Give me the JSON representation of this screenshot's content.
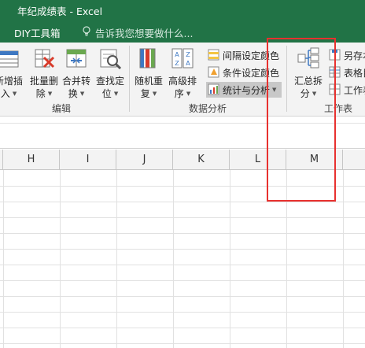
{
  "window": {
    "title": "年纪成绩表 - Excel"
  },
  "tabs": {
    "active": "DIY工具箱",
    "tell_me_placeholder": "告诉我您想要做什么..."
  },
  "ribbon": {
    "edit_group": {
      "label": "编辑",
      "buttons": [
        {
          "l1": "新增插",
          "l2": "入",
          "icon": "insert-rows-icon"
        },
        {
          "l1": "批量删",
          "l2": "除",
          "icon": "batch-delete-icon"
        },
        {
          "l1": "合并转",
          "l2": "换",
          "icon": "merge-convert-icon"
        },
        {
          "l1": "查找定",
          "l2": "位",
          "icon": "find-locate-icon"
        }
      ]
    },
    "analysis_group": {
      "label": "数据分析",
      "buttons": [
        {
          "l1": "随机重",
          "l2": "复",
          "icon": "random-repeat-icon"
        },
        {
          "l1": "高级排",
          "l2": "序",
          "icon": "advanced-sort-icon"
        }
      ],
      "small_buttons": [
        {
          "label": "间隔设定颜色",
          "icon": "interval-color-icon"
        },
        {
          "label": "条件设定颜色",
          "icon": "condition-color-icon"
        },
        {
          "label": "统计与分析",
          "icon": "statistics-analysis-icon"
        }
      ]
    },
    "sheet_group": {
      "label": "工作表",
      "summary_button": {
        "l1": "汇总拆",
        "l2": "分",
        "icon": "summary-split-icon"
      },
      "small_buttons": [
        {
          "label": "另存本",
          "icon": "save-as-icon"
        },
        {
          "label": "表格目",
          "icon": "table-directory-icon"
        },
        {
          "label": "工作表",
          "icon": "worksheet-icon"
        }
      ]
    }
  },
  "columns": [
    "H",
    "I",
    "J",
    "K",
    "L",
    "M"
  ],
  "colors": {
    "accent": "#217346",
    "highlight_box": "#e8312f"
  }
}
